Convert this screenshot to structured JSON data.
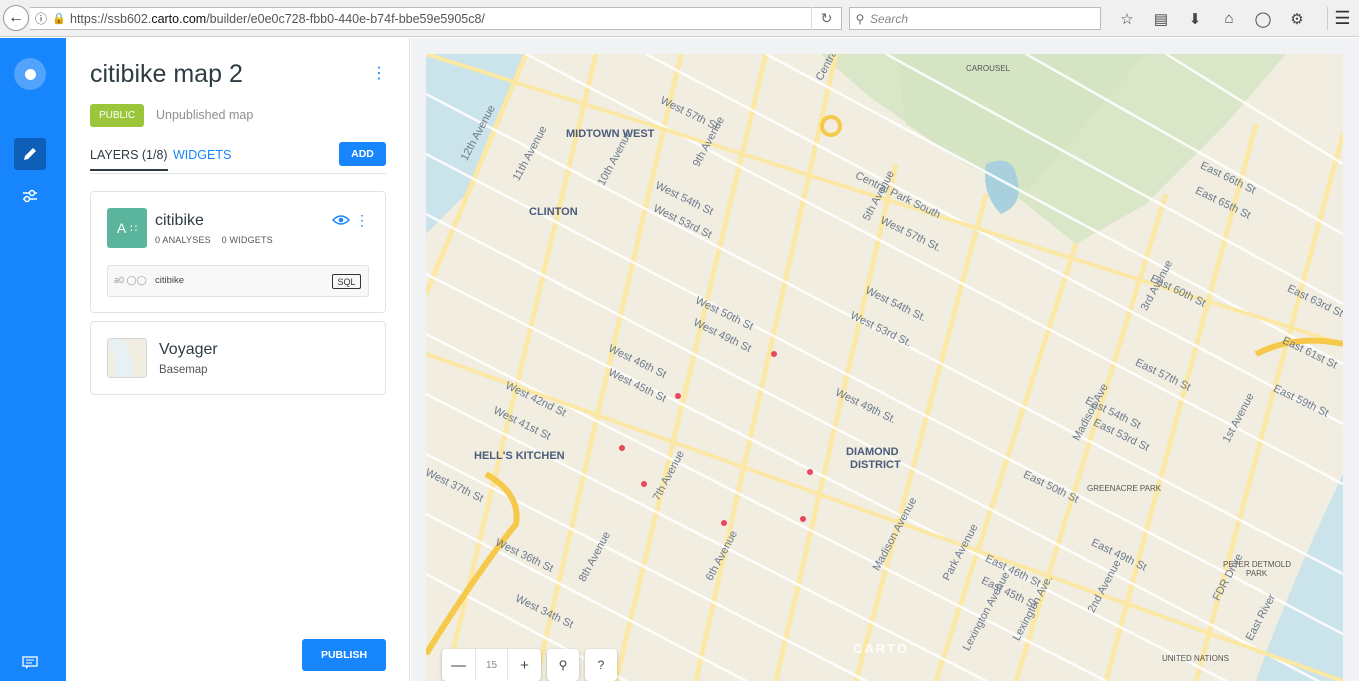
{
  "browser": {
    "url_prefix": "https://ssb602.",
    "url_domain": "carto.com",
    "url_path": "/builder/e0e0c728-fbb0-440e-b74f-bbe59e5905c8/",
    "search_placeholder": "Search"
  },
  "panel": {
    "title": "citibike map 2",
    "badge": "PUBLIC",
    "status": "Unpublished map",
    "tabs": [
      "LAYERS (1/8)",
      "WIDGETS"
    ],
    "add_label": "ADD",
    "layer": {
      "letter": "A",
      "name": "citibike",
      "analyses": "0 ANALYSES",
      "widgets": "0 WIDGETS",
      "node": "a0",
      "source": "citibike",
      "sql": "SQL"
    },
    "basemap": {
      "name": "Voyager",
      "sub": "Basemap"
    },
    "publish_label": "PUBLISH"
  },
  "map": {
    "zoom": "15",
    "watermark": "CARTO",
    "point_color": "#e8485c",
    "neighborhoods": [
      "MIDTOWN WEST",
      "CLINTON",
      "HELL'S KITCHEN",
      "DIAMOND",
      "DISTRICT",
      "CAROUSEL",
      "GREENACRE PARK",
      "PETER DETMOLD",
      "PARK",
      "UNITED NATIONS"
    ],
    "streets": [
      "West 57th St",
      "West 54th St",
      "West 53rd St",
      "West 50th St",
      "West 49th St",
      "West 46th St",
      "West 45th St",
      "West 42nd St",
      "West 41st St",
      "West 37th St",
      "West 36th St",
      "West 34th St",
      "West 54th St.",
      "West 53rd St.",
      "West 49th St.",
      "Central Park South",
      "West 57th St.",
      "East 66th St",
      "East 65th St",
      "East 60th St",
      "East 57th St",
      "East 54th St",
      "East 53rd St",
      "East 50th St",
      "East 49th St",
      "East 46th St",
      "East 45th St",
      "East 61st St",
      "East 59th St",
      "East 63rd St",
      "12th Avenue",
      "11th Avenue",
      "10th Avenue",
      "9th Avenue",
      "8th Avenue",
      "7th Avenue",
      "6th Avenue",
      "5th Avenue",
      "Madison Avenue",
      "Park Avenue",
      "Lexington Ave.",
      "3rd Avenue",
      "2nd Avenue",
      "1st Avenue",
      "FDR Drive",
      "East River",
      "Lexington Avenue",
      "Central Park",
      "Madison Ave"
    ]
  }
}
